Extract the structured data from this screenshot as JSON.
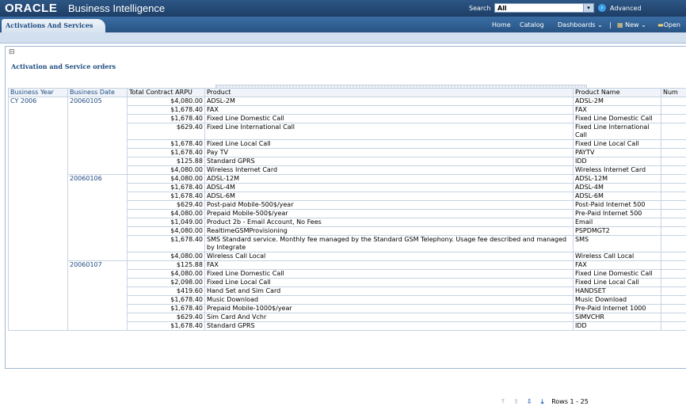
{
  "header": {
    "logo": "ORACLE",
    "app_title": "Business Intelligence",
    "search_label": "Search",
    "search_scope": "All",
    "advanced": "Advanced"
  },
  "nav": {
    "tab": "Activations And Services",
    "home": "Home",
    "catalog": "Catalog",
    "dashboards": "Dashboards",
    "new": "New",
    "open": "Open"
  },
  "report": {
    "title": "Activation and Service orders",
    "columns": [
      "Business Year",
      "Business Date",
      "Total Contract ARPU",
      "Product",
      "Product Name",
      "Num"
    ],
    "year": "CY 2006",
    "groups": [
      {
        "date": "20060105",
        "rows": [
          {
            "arpu": "$4,080.00",
            "product": "ADSL-2M",
            "name": "ADSL-2M"
          },
          {
            "arpu": "$1,678.40",
            "product": "FAX",
            "name": "FAX"
          },
          {
            "arpu": "$1,678.40",
            "product": "Fixed Line Domestic Call",
            "name": "Fixed Line Domestic Call"
          },
          {
            "arpu": "$629.40",
            "product": "Fixed Line International Call",
            "name": "Fixed Line International Call"
          },
          {
            "arpu": "$1,678.40",
            "product": "Fixed Line Local Call",
            "name": "Fixed Line Local Call"
          },
          {
            "arpu": "$1,678.40",
            "product": "Pay TV",
            "name": "PAYTV"
          },
          {
            "arpu": "$125.88",
            "product": "Standard GPRS",
            "name": "IDD"
          },
          {
            "arpu": "$4,080.00",
            "product": "Wireless Internet Card",
            "name": "Wireless Internet Card"
          }
        ]
      },
      {
        "date": "20060106",
        "rows": [
          {
            "arpu": "$4,080.00",
            "product": "ADSL-12M",
            "name": "ADSL-12M"
          },
          {
            "arpu": "$1,678.40",
            "product": "ADSL-4M",
            "name": "ADSL-4M"
          },
          {
            "arpu": "$1,678.40",
            "product": "ADSL-6M",
            "name": "ADSL-6M"
          },
          {
            "arpu": "$629.40",
            "product": "Post-paid Mobile-500$/year",
            "name": "Post-Paid Internet 500"
          },
          {
            "arpu": "$4,080.00",
            "product": "Prepaid Mobile-500$/year",
            "name": "Pre-Paid Internet 500"
          },
          {
            "arpu": "$1,049.00",
            "product": "Product 2b - Email Account, No Fees",
            "name": "Email"
          },
          {
            "arpu": "$4,080.00",
            "product": "RealtimeGSMProvisioning",
            "name": "PSPDMGT2"
          },
          {
            "arpu": "$1,678.40",
            "product": "SMS Standard service. Monthly fee managed by the Standard GSM Telephony. Usage fee described and managed by Integrate",
            "name": "SMS"
          },
          {
            "arpu": "$4,080.00",
            "product": "Wireless Call Local",
            "name": "Wireless Call Local"
          }
        ]
      },
      {
        "date": "20060107",
        "rows": [
          {
            "arpu": "$125.88",
            "product": "FAX",
            "name": "FAX"
          },
          {
            "arpu": "$4,080.00",
            "product": "Fixed Line Domestic Call",
            "name": "Fixed Line Domestic Call"
          },
          {
            "arpu": "$2,098.00",
            "product": "Fixed Line Local Call",
            "name": "Fixed Line Local Call"
          },
          {
            "arpu": "$419.60",
            "product": "Hand Set and Sim Card",
            "name": "HANDSET"
          },
          {
            "arpu": "$1,678.40",
            "product": "Music Download",
            "name": "Music Download"
          },
          {
            "arpu": "$1,678.40",
            "product": "Prepaid Mobile-1000$/year",
            "name": "Pre-Paid Internet 1000"
          },
          {
            "arpu": "$629.40",
            "product": "Sim Card And Vchr",
            "name": "SIMVCHR"
          },
          {
            "arpu": "$1,678.40",
            "product": "Standard GPRS",
            "name": "IDD"
          }
        ]
      }
    ],
    "rows_label": "Rows 1 - 25"
  },
  "colors": {
    "header_bg": "#1d3e66",
    "link": "#1d4a80",
    "border": "#c6d3e2"
  }
}
